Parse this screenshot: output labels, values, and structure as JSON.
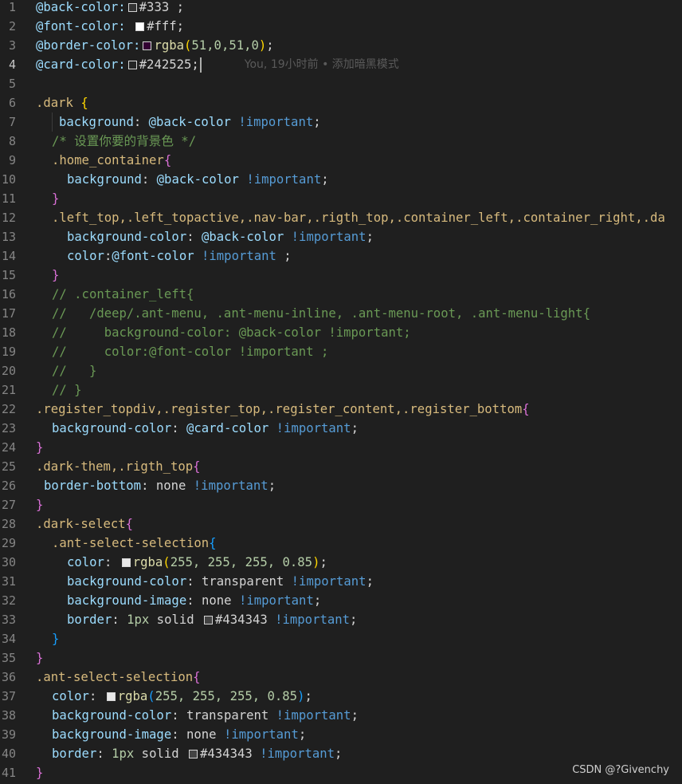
{
  "lines": [
    {
      "n": "1",
      "parts": [
        "@back-color:",
        "#333 ;"
      ]
    },
    {
      "n": "2",
      "parts": [
        "@font-color: ",
        "#fff;"
      ]
    },
    {
      "n": "3",
      "parts": [
        "@border-color:",
        "rgba",
        "(",
        "51,0,51,0",
        ")",
        ";"
      ]
    },
    {
      "n": "4",
      "parts": [
        "@card-color:",
        "#242525;"
      ]
    },
    {
      "n": "5",
      "parts": []
    },
    {
      "n": "6",
      "parts": [
        ".dark ",
        "{"
      ]
    },
    {
      "n": "7",
      "parts": [
        "background",
        ": ",
        "@back-color",
        " !important",
        ";"
      ]
    },
    {
      "n": "8",
      "parts": [
        "/* 设置你要的背景色 */"
      ]
    },
    {
      "n": "9",
      "parts": [
        ".home_container",
        "{"
      ]
    },
    {
      "n": "10",
      "parts": [
        "background",
        ": ",
        "@back-color",
        " !important",
        ";"
      ]
    },
    {
      "n": "11",
      "parts": [
        "}"
      ]
    },
    {
      "n": "12",
      "parts": [
        ".left_top,.left_topactive,.nav-bar,.rigth_top,.container_left,.container_right,.da"
      ]
    },
    {
      "n": "13",
      "parts": [
        "background-color",
        ": ",
        "@back-color",
        " !important",
        ";"
      ]
    },
    {
      "n": "14",
      "parts": [
        "color",
        ":",
        "@font-color",
        " !important",
        " ;"
      ]
    },
    {
      "n": "15",
      "parts": [
        "}"
      ]
    },
    {
      "n": "16",
      "parts": [
        "// .container_left{"
      ]
    },
    {
      "n": "17",
      "parts": [
        "//   /deep/.ant-menu, .ant-menu-inline, .ant-menu-root, .ant-menu-light{"
      ]
    },
    {
      "n": "18",
      "parts": [
        "//     background-color: @back-color !important;"
      ]
    },
    {
      "n": "19",
      "parts": [
        "//     color:@font-color !important ;"
      ]
    },
    {
      "n": "20",
      "parts": [
        "//   }"
      ]
    },
    {
      "n": "21",
      "parts": [
        "// }"
      ]
    },
    {
      "n": "22",
      "parts": [
        ".register_topdiv,.register_top,.register_content,.register_bottom",
        "{"
      ]
    },
    {
      "n": "23",
      "parts": [
        "background-color",
        ": ",
        "@card-color",
        " !important",
        ";"
      ]
    },
    {
      "n": "24",
      "parts": [
        "}"
      ]
    },
    {
      "n": "25",
      "parts": [
        ".dark-them,.rigth_top",
        "{"
      ]
    },
    {
      "n": "26",
      "parts": [
        "border-bottom",
        ": ",
        "none",
        " !important",
        ";"
      ]
    },
    {
      "n": "27",
      "parts": [
        "}"
      ]
    },
    {
      "n": "28",
      "parts": [
        ".dark-select",
        "{"
      ]
    },
    {
      "n": "29",
      "parts": [
        ".ant-select-selection",
        "{"
      ]
    },
    {
      "n": "30",
      "parts": [
        "color",
        ": ",
        "rgba",
        "(",
        "255, 255, 255, 0.85",
        ")",
        ";"
      ]
    },
    {
      "n": "31",
      "parts": [
        "background-color",
        ": ",
        "transparent",
        " !important",
        ";"
      ]
    },
    {
      "n": "32",
      "parts": [
        "background-image",
        ": ",
        "none",
        " !important",
        ";"
      ]
    },
    {
      "n": "33",
      "parts": [
        "border",
        ": ",
        "1px",
        " solid ",
        "#434343",
        " !important",
        ";"
      ]
    },
    {
      "n": "34",
      "parts": [
        "}"
      ]
    },
    {
      "n": "35",
      "parts": [
        "}"
      ]
    },
    {
      "n": "36",
      "parts": [
        ".ant-select-selection",
        "{"
      ]
    },
    {
      "n": "37",
      "parts": [
        "color",
        ": ",
        "rgba",
        "(",
        "255, 255, 255, 0.85",
        ")",
        ";"
      ]
    },
    {
      "n": "38",
      "parts": [
        "background-color",
        ": ",
        "transparent",
        " !important",
        ";"
      ]
    },
    {
      "n": "39",
      "parts": [
        "background-image",
        ": ",
        "none",
        " !important",
        ";"
      ]
    },
    {
      "n": "40",
      "parts": [
        "border",
        ": ",
        "1px",
        " solid ",
        "#434343",
        " !important",
        ";"
      ]
    },
    {
      "n": "41",
      "parts": [
        "}"
      ]
    }
  ],
  "blame": "You, 19小时前 • 添加暗黑模式",
  "watermark": "CSDN @?Givenchy",
  "colors": {
    "swatch_back": "#333333",
    "swatch_font": "#ffffff",
    "swatch_border": "#330033",
    "swatch_card": "#242525",
    "swatch_rgba": "#e8e8e8",
    "swatch_border_434343": "#434343"
  }
}
